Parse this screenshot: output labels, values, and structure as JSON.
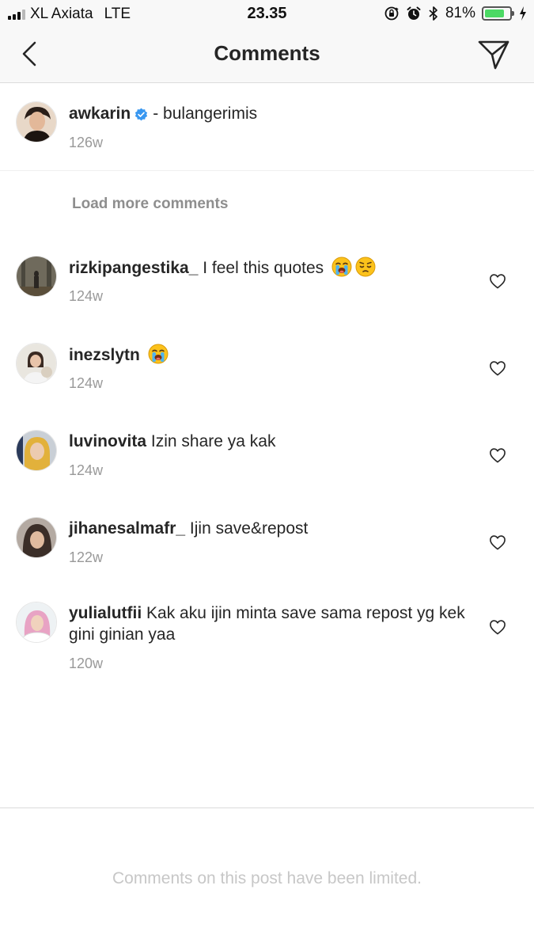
{
  "status_bar": {
    "carrier": "XL Axiata",
    "network": "LTE",
    "time": "23.35",
    "battery_percent": "81%",
    "battery_level": 0.81,
    "icons": [
      "orientation-lock-icon",
      "alarm-icon",
      "bluetooth-icon",
      "charging-icon"
    ]
  },
  "nav": {
    "title": "Comments",
    "back_icon": "chevron-left-icon",
    "send_icon": "paper-plane-icon"
  },
  "caption": {
    "username": "awkarin",
    "verified": true,
    "text": "- bulangerimis",
    "time": "126w"
  },
  "load_more_label": "Load more comments",
  "comments": [
    {
      "username": "rizkipangestika_",
      "text": "I feel this quotes",
      "emojis": [
        "loudly-crying-face",
        "pensive-face"
      ],
      "time": "124w"
    },
    {
      "username": "inezslytn",
      "text": "",
      "emojis": [
        "loudly-crying-face"
      ],
      "time": "124w"
    },
    {
      "username": "luvinovita",
      "text": "Izin share ya kak",
      "emojis": [],
      "time": "124w"
    },
    {
      "username": "jihanesalmafr_",
      "text": "Ijin save&repost",
      "emojis": [],
      "time": "122w"
    },
    {
      "username": "yulialutfii",
      "text": "Kak aku ijin minta save sama repost yg kek gini ginian yaa",
      "emojis": [],
      "time": "120w"
    }
  ],
  "footer": {
    "limited_text": "Comments on this post have been limited."
  },
  "colors": {
    "verified_blue": "#3897f0",
    "timestamp_gray": "#999999",
    "load_more_gray": "#8e8e8e",
    "battery_green": "#4cd964"
  }
}
